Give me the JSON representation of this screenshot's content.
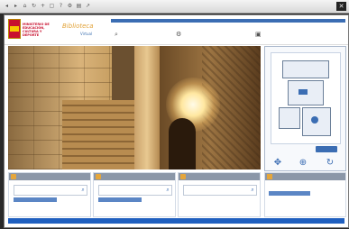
{
  "window": {
    "close_glyph": "✕",
    "toolbar_icons": [
      "back-icon",
      "forward-icon",
      "home-icon",
      "refresh-icon",
      "zoom-icon",
      "fullscreen-icon",
      "help-icon",
      "settings-icon",
      "print-icon",
      "share-icon"
    ]
  },
  "header": {
    "ministry_text": "MINISTERIO DE EDUCACIÓN, CULTURA Y DEPORTE",
    "library_name": "Biblioteca",
    "library_sub": "Virtual",
    "top_bar_text": "",
    "links": [
      {
        "label": "",
        "icon": "search-icon"
      },
      {
        "label": "",
        "icon": "gear-icon"
      },
      {
        "label": "",
        "icon": "camera-icon"
      }
    ]
  },
  "viewer": {
    "map_label": "",
    "accent_color": "#3b6db3"
  },
  "panels": [
    {
      "title": "",
      "field_value": "",
      "link_label": ""
    },
    {
      "title": "",
      "field_value": "",
      "link_label": ""
    },
    {
      "title": "",
      "field_value": "",
      "link_label": ""
    }
  ],
  "side_panel": {
    "title": "",
    "text": "",
    "link_label": ""
  },
  "footer": {
    "text": ""
  }
}
